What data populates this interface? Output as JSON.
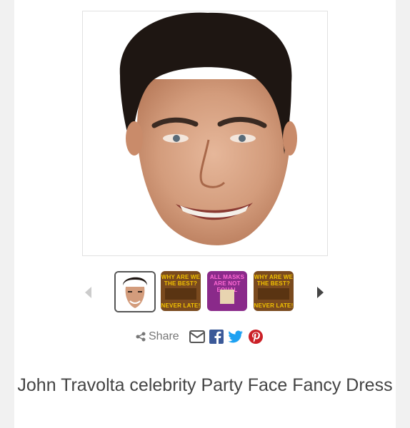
{
  "product": {
    "title": "John Travolta celebrity Party Face Fancy Dress",
    "main_image": "celebrity-face-mask-photo"
  },
  "gallery": {
    "prev_icon": "chevron-left-icon",
    "next_icon": "chevron-right-icon",
    "thumbnails": [
      {
        "kind": "face-photo",
        "selected": true
      },
      {
        "kind": "promo",
        "heading": "WHY ARE WE THE BEST?",
        "footer": "NEVER LATE!",
        "bg": "#7a4a1e",
        "accent": "#f2c200"
      },
      {
        "kind": "promo",
        "heading": "ALL MASKS ARE NOT EQUAL",
        "footer": "",
        "bg": "#8a2a8a",
        "accent": "#ff6ad5"
      },
      {
        "kind": "promo",
        "heading": "WHY ARE WE THE BEST?",
        "footer": "NEVER LATE!",
        "bg": "#7a4a1e",
        "accent": "#f2c200"
      }
    ]
  },
  "share": {
    "label": "Share",
    "share_icon": "share-icon",
    "email_icon": "envelope-icon",
    "facebook_icon": "facebook-icon",
    "twitter_icon": "twitter-icon",
    "pinterest_icon": "pinterest-icon",
    "colors": {
      "facebook": "#3b5998",
      "twitter": "#1da1f2",
      "pinterest": "#cb2027",
      "label": "#777777"
    }
  }
}
